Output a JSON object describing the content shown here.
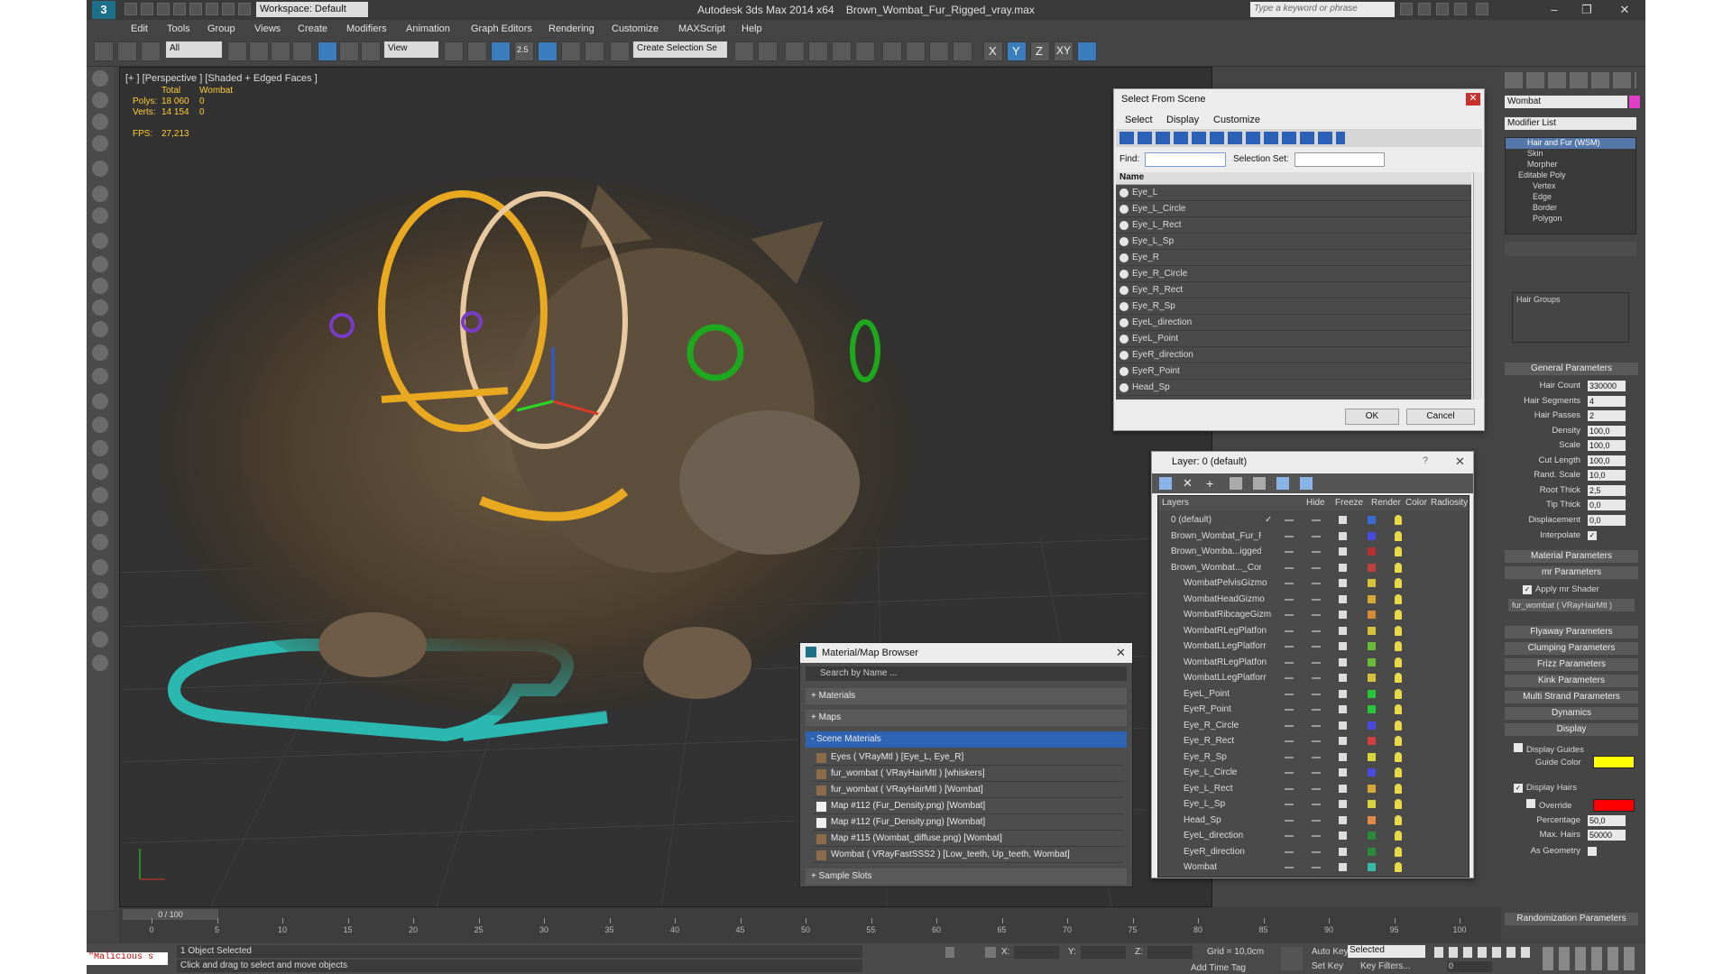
{
  "window": {
    "app_title": "Autodesk 3ds Max  2014 x64",
    "file_title": "Brown_Wombat_Fur_Rigged_vray.max",
    "workspace": "Workspace: Default",
    "search_placeholder": "Type a keyword or phrase"
  },
  "menu": [
    "Edit",
    "Tools",
    "Group",
    "Views",
    "Create",
    "Modifiers",
    "Animation",
    "Graph Editors",
    "Rendering",
    "Customize",
    "MAXScript",
    "Help"
  ],
  "toolbar": {
    "selection_filter": "All",
    "ref_coord": "View",
    "named_selection": "Create Selection Se",
    "axes": [
      "X",
      "Y",
      "Z",
      "XY"
    ],
    "snap_label": "2.5"
  },
  "viewport": {
    "label": "[+ ] [Perspective ] [Shaded + Edged Faces ]",
    "stats": {
      "col_total": "Total",
      "col_object": "Wombat",
      "polys_label": "Polys:",
      "polys_total": "18 060",
      "polys_obj": "0",
      "verts_label": "Verts:",
      "verts_total": "14 154",
      "verts_obj": "0",
      "fps_label": "FPS:",
      "fps": "27,213"
    }
  },
  "select_from_scene": {
    "title": "Select From Scene",
    "menu": [
      "Select",
      "Display",
      "Customize"
    ],
    "find_label": "Find:",
    "selection_set_label": "Selection Set:",
    "column": "Name",
    "items": [
      "Eye_L",
      "Eye_L_Circle",
      "Eye_L_Rect",
      "Eye_L_Sp",
      "Eye_R",
      "Eye_R_Circle",
      "Eye_R_Rect",
      "Eye_R_Sp",
      "EyeL_direction",
      "EyeL_Point",
      "EyeR_direction",
      "EyeR_Point",
      "Head_Sp"
    ],
    "ok": "OK",
    "cancel": "Cancel"
  },
  "layer_dialog": {
    "title": "Layer: 0 (default)",
    "headers": [
      "Layers",
      "Hide",
      "Freeze",
      "Render",
      "Color",
      "Radiosity"
    ],
    "rows": [
      {
        "name": "0 (default)",
        "level": 0,
        "color": "#3a6bd6",
        "check": true
      },
      {
        "name": "Brown_Wombat_Fur_Ri",
        "level": 0,
        "color": "#4a4ae0"
      },
      {
        "name": "Brown_Womba...igged_",
        "level": 0,
        "color": "#b83030"
      },
      {
        "name": "Brown_Wombat..._Con",
        "level": 0,
        "color": "#c04040"
      },
      {
        "name": "WombatPelvisGizmo",
        "level": 1,
        "color": "#d6c23a"
      },
      {
        "name": "WombatHeadGizmo",
        "level": 1,
        "color": "#d6a83a"
      },
      {
        "name": "WombatRibcageGizm",
        "level": 1,
        "color": "#d68a3a"
      },
      {
        "name": "WombatRLegPlatfon",
        "level": 1,
        "color": "#d6c23a"
      },
      {
        "name": "WombatLLegPlatforr",
        "level": 1,
        "color": "#6abb3a"
      },
      {
        "name": "WombatRLegPlatfon",
        "level": 1,
        "color": "#6abb3a"
      },
      {
        "name": "WombatLLegPlatforr",
        "level": 1,
        "color": "#d6c23a"
      },
      {
        "name": "EyeL_Point",
        "level": 1,
        "color": "#2ac43a"
      },
      {
        "name": "EyeR_Point",
        "level": 1,
        "color": "#2ac43a"
      },
      {
        "name": "Eye_R_Circle",
        "level": 1,
        "color": "#4a4ae0"
      },
      {
        "name": "Eye_R_Rect",
        "level": 1,
        "color": "#d04040"
      },
      {
        "name": "Eye_R_Sp",
        "level": 1,
        "color": "#d6d63a"
      },
      {
        "name": "Eye_L_Circle",
        "level": 1,
        "color": "#4a4ae0"
      },
      {
        "name": "Eye_L_Rect",
        "level": 1,
        "color": "#d6a83a"
      },
      {
        "name": "Eye_L_Sp",
        "level": 1,
        "color": "#d6d63a"
      },
      {
        "name": "Head_Sp",
        "level": 1,
        "color": "#e08a4a"
      },
      {
        "name": "EyeL_direction",
        "level": 1,
        "color": "#2a8a3a"
      },
      {
        "name": "EyeR_direction",
        "level": 1,
        "color": "#2a8a3a"
      },
      {
        "name": "Wombat",
        "level": 1,
        "color": "#3ab8a8"
      }
    ]
  },
  "material_browser": {
    "title": "Material/Map Browser",
    "search": "Search by Name ...",
    "sections": [
      "+ Materials",
      "+ Maps",
      "- Scene Materials",
      "+ Sample Slots"
    ],
    "items": [
      "Eyes  ( VRayMtl )  [Eye_L, Eye_R]",
      "fur_wombat  ( VRayHairMtl )  [whiskers]",
      "fur_wombat  ( VRayHairMtl )  [Wombat]",
      "Map #112 (Fur_Density.png)  [Wombat]",
      "Map #112 (Fur_Density.png)  [Wombat]",
      "Map #115 (Wombat_diffuse.png)  [Wombat]",
      "Wombat  ( VRayFastSSS2 )  [Low_teeth, Up_teeth, Wombat]"
    ]
  },
  "command_panel": {
    "object_name": "Wombat",
    "object_color": "#e040c8",
    "modifier_list": "Modifier List",
    "stack": [
      "Hair and Fur (WSM)",
      "Skin",
      "Morpher",
      "Editable Poly",
      "Vertex",
      "Edge",
      "Border",
      "Polygon"
    ],
    "hair_groups": "Hair Groups",
    "rollouts": {
      "general": "General Parameters",
      "material": "Material Parameters",
      "mr": "mr Parameters",
      "flyaway": "Flyaway Parameters",
      "clumping": "Clumping Parameters",
      "frizz": "Frizz Parameters",
      "kink": "Kink Parameters",
      "multi": "Multi Strand Parameters",
      "dynamics": "Dynamics",
      "display": "Display",
      "randomization": "Randomization Parameters"
    },
    "params": [
      {
        "label": "Hair Count",
        "value": "330000"
      },
      {
        "label": "Hair Segments",
        "value": "4"
      },
      {
        "label": "Hair Passes",
        "value": "2"
      },
      {
        "label": "Density",
        "value": "100,0"
      },
      {
        "label": "Scale",
        "value": "100,0"
      },
      {
        "label": "Cut Length",
        "value": "100,0"
      },
      {
        "label": "Rand. Scale",
        "value": "10,0"
      },
      {
        "label": "Root Thick",
        "value": "2,5"
      },
      {
        "label": "Tip Thick",
        "value": "0,0"
      },
      {
        "label": "Displacement",
        "value": "0,0"
      }
    ],
    "interpolate": "Interpolate",
    "apply_mr": "Apply mr Shader",
    "mr_shader": "fur_wombat  ( VRayHairMtl )",
    "display_guides": "Display Guides",
    "guide_color": "Guide Color",
    "guide_color_value": "#ffff00",
    "display_hairs": "Display Hairs",
    "override": "Override",
    "override_color": "#ff0000",
    "percentage_label": "Percentage",
    "percentage": "50,0",
    "max_hairs_label": "Max. Hairs",
    "max_hairs": "50000",
    "as_geometry": "As Geometry"
  },
  "timeline": {
    "frame": "0 / 100",
    "ticks": [
      "0",
      "5",
      "10",
      "15",
      "20",
      "25",
      "30",
      "35",
      "40",
      "45",
      "50",
      "55",
      "60",
      "65",
      "70",
      "75",
      "80",
      "85",
      "90",
      "95",
      "100"
    ]
  },
  "status": {
    "listener": "\"Malicious s",
    "selected": "1 Object Selected",
    "prompt": "Click and drag to select and move objects",
    "x_label": "X:",
    "y_label": "Y:",
    "z_label": "Z:",
    "grid": "Grid = 10,0cm",
    "auto_key": "Auto Key",
    "set_key": "Set Key",
    "key_mode": "Selected",
    "key_filters": "Key Filters...",
    "add_time_tag": "Add Time Tag",
    "frame_value": "0"
  }
}
